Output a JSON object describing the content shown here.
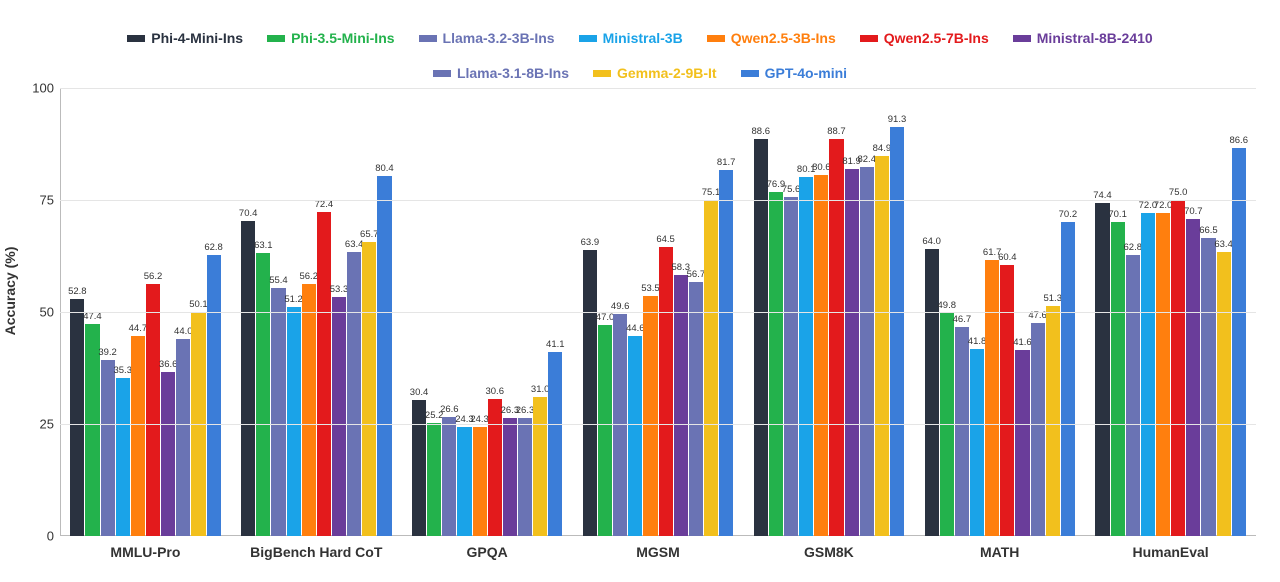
{
  "chart_data": {
    "type": "bar",
    "ylabel": "Accuracy (%)",
    "xlabel": "",
    "ylim": [
      0,
      100
    ],
    "yticks": [
      0,
      25,
      50,
      75,
      100
    ],
    "categories": [
      "MMLU-Pro",
      "BigBench Hard CoT",
      "GPQA",
      "MGSM",
      "GSM8K",
      "MATH",
      "HumanEval"
    ],
    "series": [
      {
        "name": "Phi-4-Mini-Ins",
        "color": "#2a3240",
        "values": [
          52.8,
          70.4,
          30.4,
          63.9,
          88.6,
          64.0,
          74.4
        ]
      },
      {
        "name": "Phi-3.5-Mini-Ins",
        "color": "#23b24c",
        "values": [
          47.4,
          63.1,
          25.2,
          47.0,
          76.9,
          49.8,
          70.1
        ]
      },
      {
        "name": "Llama-3.2-3B-Ins",
        "color": "#6a73b4",
        "values": [
          39.2,
          55.4,
          26.6,
          49.6,
          75.6,
          46.7,
          62.8
        ]
      },
      {
        "name": "Ministral-3B",
        "color": "#1aa3e8",
        "values": [
          35.3,
          51.2,
          24.3,
          44.6,
          80.1,
          41.8,
          72.0
        ]
      },
      {
        "name": "Qwen2.5-3B-Ins",
        "color": "#ff7f0e",
        "values": [
          44.7,
          56.2,
          24.3,
          53.5,
          80.6,
          61.7,
          72.0
        ]
      },
      {
        "name": "Qwen2.5-7B-Ins",
        "color": "#e31a1c",
        "values": [
          56.2,
          72.4,
          30.6,
          64.5,
          88.7,
          60.4,
          75.0
        ]
      },
      {
        "name": "Ministral-8B-2410",
        "color": "#6a3d9a",
        "values": [
          36.6,
          53.3,
          26.3,
          58.3,
          81.9,
          41.6,
          70.7
        ]
      },
      {
        "name": "Llama-3.1-8B-Ins",
        "color": "#6a73b4",
        "values": [
          44.0,
          63.4,
          26.3,
          56.7,
          82.4,
          47.6,
          66.5
        ]
      },
      {
        "name": "Gemma-2-9B-It",
        "color": "#f2c01d",
        "values": [
          50.1,
          65.7,
          31.0,
          75.1,
          84.9,
          51.3,
          63.4
        ]
      },
      {
        "name": "GPT-4o-mini",
        "color": "#3b7dd8",
        "values": [
          62.8,
          80.4,
          41.1,
          81.7,
          91.3,
          70.2,
          86.6
        ]
      }
    ],
    "legend_position": "top"
  }
}
